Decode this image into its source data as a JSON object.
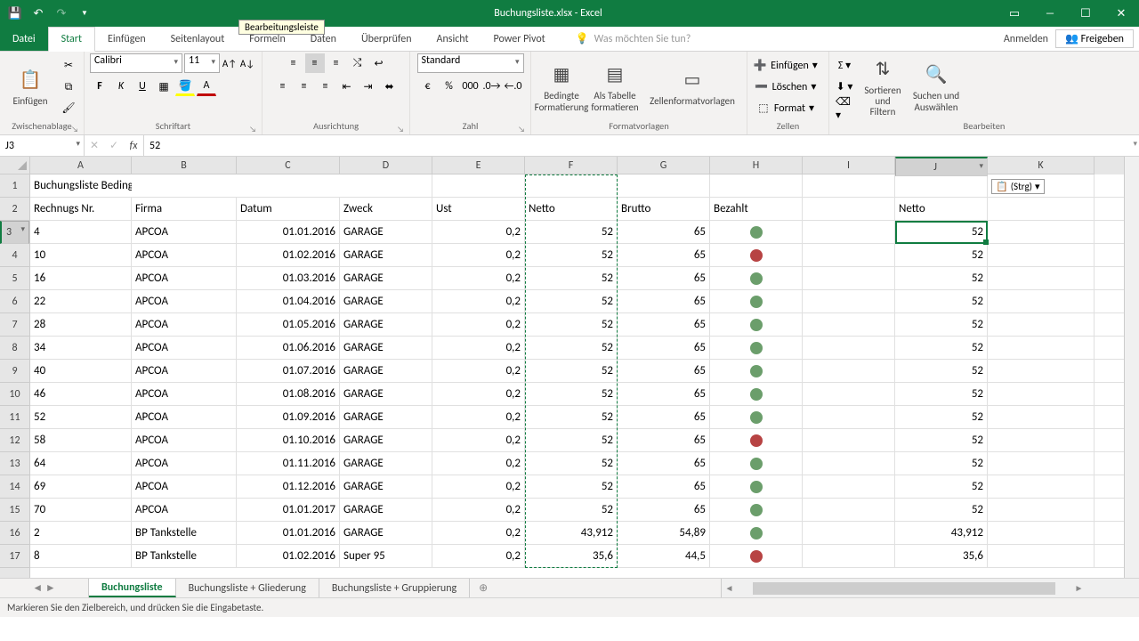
{
  "titlebar": {
    "title": "Buchungsliste.xlsx - Excel"
  },
  "tabs": {
    "file": "Datei",
    "items": [
      "Start",
      "Einfügen",
      "Seitenlayout",
      "Formeln",
      "Daten",
      "Überprüfen",
      "Ansicht",
      "Power Pivot"
    ],
    "active": "Start",
    "tell": "Was möchten Sie tun?",
    "login": "Anmelden",
    "share": "Freigeben"
  },
  "ribbon": {
    "clipboard": {
      "label": "Zwischenablage",
      "paste": "Einfügen"
    },
    "font": {
      "label": "Schriftart",
      "name": "Calibri",
      "size": "11"
    },
    "align": {
      "label": "Ausrichtung"
    },
    "number": {
      "label": "Zahl",
      "format": "Standard"
    },
    "styles": {
      "label": "Formatvorlagen",
      "cond": "Bedingte\nFormatierung",
      "table": "Als Tabelle\nformatieren",
      "cell": "Zellenformatvorlagen"
    },
    "cells": {
      "label": "Zellen",
      "insert": "Einfügen",
      "delete": "Löschen",
      "format": "Format"
    },
    "editing": {
      "label": "Bearbeiten",
      "sort": "Sortieren und\nFiltern",
      "find": "Suchen und\nAuswählen"
    }
  },
  "namebox": "J3",
  "formula": "52",
  "tooltip": "Bearbeitungsleiste",
  "columns": [
    {
      "letter": "A",
      "w": 114
    },
    {
      "letter": "B",
      "w": 118
    },
    {
      "letter": "C",
      "w": 116
    },
    {
      "letter": "D",
      "w": 104
    },
    {
      "letter": "E",
      "w": 104
    },
    {
      "letter": "F",
      "w": 104
    },
    {
      "letter": "G",
      "w": 104
    },
    {
      "letter": "H",
      "w": 104
    },
    {
      "letter": "I",
      "w": 104
    },
    {
      "letter": "J",
      "w": 104
    },
    {
      "letter": "K",
      "w": 120
    }
  ],
  "activeCol": "J",
  "activeRow": 3,
  "title_cell": "Buchungsliste Bedingte Formatierung",
  "headers": {
    "A": "Rechnugs Nr.",
    "B": "Firma",
    "C": "Datum",
    "D": "Zweck",
    "E": "Ust",
    "F": "Netto",
    "G": "Brutto",
    "H": "Bezahlt",
    "J": "Netto"
  },
  "rows": [
    {
      "n": 3,
      "A": "4",
      "B": "APCOA",
      "C": "01.01.2016",
      "D": "GARAGE",
      "E": "0,2",
      "F": "52",
      "G": "65",
      "H": "green",
      "J": "52"
    },
    {
      "n": 4,
      "A": "10",
      "B": "APCOA",
      "C": "01.02.2016",
      "D": "GARAGE",
      "E": "0,2",
      "F": "52",
      "G": "65",
      "H": "red",
      "J": "52"
    },
    {
      "n": 5,
      "A": "16",
      "B": "APCOA",
      "C": "01.03.2016",
      "D": "GARAGE",
      "E": "0,2",
      "F": "52",
      "G": "65",
      "H": "green",
      "J": "52"
    },
    {
      "n": 6,
      "A": "22",
      "B": "APCOA",
      "C": "01.04.2016",
      "D": "GARAGE",
      "E": "0,2",
      "F": "52",
      "G": "65",
      "H": "green",
      "J": "52"
    },
    {
      "n": 7,
      "A": "28",
      "B": "APCOA",
      "C": "01.05.2016",
      "D": "GARAGE",
      "E": "0,2",
      "F": "52",
      "G": "65",
      "H": "green",
      "J": "52"
    },
    {
      "n": 8,
      "A": "34",
      "B": "APCOA",
      "C": "01.06.2016",
      "D": "GARAGE",
      "E": "0,2",
      "F": "52",
      "G": "65",
      "H": "green",
      "J": "52"
    },
    {
      "n": 9,
      "A": "40",
      "B": "APCOA",
      "C": "01.07.2016",
      "D": "GARAGE",
      "E": "0,2",
      "F": "52",
      "G": "65",
      "H": "green",
      "J": "52"
    },
    {
      "n": 10,
      "A": "46",
      "B": "APCOA",
      "C": "01.08.2016",
      "D": "GARAGE",
      "E": "0,2",
      "F": "52",
      "G": "65",
      "H": "green",
      "J": "52"
    },
    {
      "n": 11,
      "A": "52",
      "B": "APCOA",
      "C": "01.09.2016",
      "D": "GARAGE",
      "E": "0,2",
      "F": "52",
      "G": "65",
      "H": "green",
      "J": "52"
    },
    {
      "n": 12,
      "A": "58",
      "B": "APCOA",
      "C": "01.10.2016",
      "D": "GARAGE",
      "E": "0,2",
      "F": "52",
      "G": "65",
      "H": "red",
      "J": "52"
    },
    {
      "n": 13,
      "A": "64",
      "B": "APCOA",
      "C": "01.11.2016",
      "D": "GARAGE",
      "E": "0,2",
      "F": "52",
      "G": "65",
      "H": "green",
      "J": "52"
    },
    {
      "n": 14,
      "A": "69",
      "B": "APCOA",
      "C": "01.12.2016",
      "D": "GARAGE",
      "E": "0,2",
      "F": "52",
      "G": "65",
      "H": "green",
      "J": "52"
    },
    {
      "n": 15,
      "A": "70",
      "B": "APCOA",
      "C": "01.01.2017",
      "D": "GARAGE",
      "E": "0,2",
      "F": "52",
      "G": "65",
      "H": "green",
      "J": "52"
    },
    {
      "n": 16,
      "A": "2",
      "B": "BP Tankstelle",
      "C": "01.01.2016",
      "D": "GARAGE",
      "E": "0,2",
      "F": "43,912",
      "G": "54,89",
      "H": "green",
      "J": "43,912"
    },
    {
      "n": 17,
      "A": "8",
      "B": "BP Tankstelle",
      "C": "01.02.2016",
      "D": "Super 95",
      "E": "0,2",
      "F": "35,6",
      "G": "44,5",
      "H": "red",
      "J": "35,6"
    }
  ],
  "smarttag": "(Strg)",
  "sheets": {
    "active": "Buchungsliste",
    "others": [
      "Buchungsliste + Gliederung",
      "Buchungsliste + Gruppierung"
    ]
  },
  "status": "Markieren Sie den Zielbereich, und drücken Sie die Eingabetaste."
}
